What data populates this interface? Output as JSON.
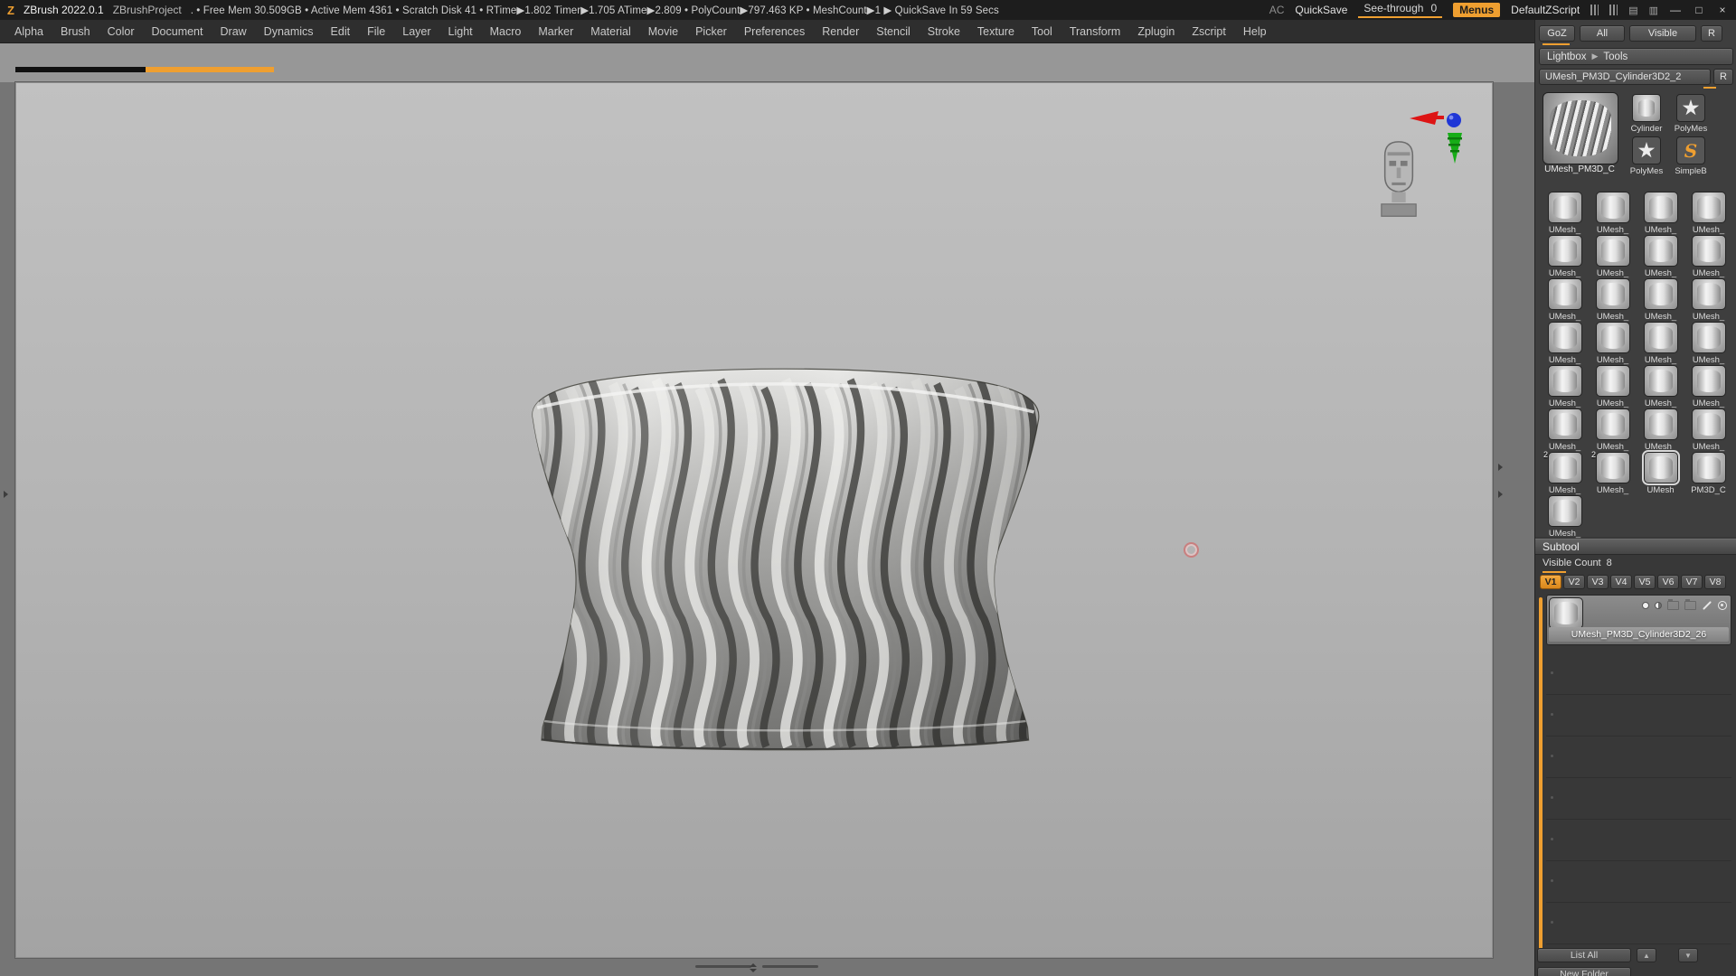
{
  "accent_color": "#ef9f30",
  "title_bar": {
    "logo": "Z",
    "app_name": "ZBrush 2022.0.1",
    "project_name": "ZBrushProject",
    "stats_prefix": ".",
    "stats": [
      {
        "sep": "•",
        "text": "Free Mem 30.509GB"
      },
      {
        "sep": "•",
        "text": "Active Mem 4361"
      },
      {
        "sep": "•",
        "text": "Scratch Disk 41"
      },
      {
        "sep": "•",
        "text": "RTime▶1.802"
      },
      {
        "sep": "",
        "text": "Timer▶1.705"
      },
      {
        "sep": "",
        "text": "ATime▶2.809"
      },
      {
        "sep": "•",
        "text": "PolyCount▶797.463 KP"
      },
      {
        "sep": "•",
        "text": "MeshCount▶1"
      },
      {
        "sep": "▶",
        "text": "QuickSave In 59 Secs"
      }
    ],
    "right": {
      "ac": "AC",
      "quicksave": "QuickSave",
      "see_through_label": "See-through",
      "see_through_value": "0",
      "menus": "Menus",
      "default_zscript": "DefaultZScript"
    }
  },
  "icons": {
    "minimize": "—",
    "restore": "□",
    "close": "×",
    "panel_a": "▤",
    "panel_b": "▥",
    "arrow_right": "▶",
    "up": "▲",
    "down": "▼"
  },
  "menu_bar": {
    "items": [
      "Alpha",
      "Brush",
      "Color",
      "Document",
      "Draw",
      "Dynamics",
      "Edit",
      "File",
      "Layer",
      "Light",
      "Macro",
      "Marker",
      "Material",
      "Movie",
      "Picker",
      "Preferences",
      "Render",
      "Stencil",
      "Stroke",
      "Texture",
      "Tool",
      "Transform",
      "Zplugin",
      "Zscript",
      "Help"
    ]
  },
  "right_panel": {
    "top_buttons": {
      "goz": "GoZ",
      "all": "All",
      "visible": "Visible",
      "r": "R"
    },
    "lightbox_label": "Lightbox",
    "tools_label": "Tools",
    "tool_name": "UMesh_PM3D_Cylinder3D2_2",
    "tool_r": "R",
    "active_tool_label": "UMesh_PM3D_C",
    "quick_items": [
      {
        "label": "Cylinder",
        "kind": "cylinder"
      },
      {
        "label": "PolyMes",
        "kind": "star"
      },
      {
        "label": "PolyMes",
        "kind": "star"
      },
      {
        "label": "SimpleB",
        "kind": "s"
      }
    ],
    "recent_tools": [
      {
        "label": "UMesh_"
      },
      {
        "label": "UMesh_"
      },
      {
        "label": "UMesh_"
      },
      {
        "label": "UMesh_"
      },
      {
        "label": "UMesh_"
      },
      {
        "label": "UMesh_"
      },
      {
        "label": "UMesh_"
      },
      {
        "label": "UMesh_"
      },
      {
        "label": "UMesh_"
      },
      {
        "label": "UMesh_"
      },
      {
        "label": "UMesh_"
      },
      {
        "label": "UMesh_"
      },
      {
        "label": "UMesh_"
      },
      {
        "label": "UMesh_"
      },
      {
        "label": "UMesh_"
      },
      {
        "label": "UMesh_"
      },
      {
        "label": "UMesh_"
      },
      {
        "label": "UMesh_"
      },
      {
        "label": "UMesh_"
      },
      {
        "label": "UMesh_"
      },
      {
        "label": "UMesh_"
      },
      {
        "label": "UMesh_"
      },
      {
        "label": "UMesh_"
      },
      {
        "label": "UMesh_"
      },
      {
        "label": "UMesh_",
        "badge": "2"
      },
      {
        "label": "UMesh_",
        "badge": "2"
      },
      {
        "label": "UMesh",
        "selected": true
      },
      {
        "label": "PM3D_C"
      },
      {
        "label": "UMesh_"
      }
    ],
    "subtool": {
      "header": "Subtool",
      "visible_count_label": "Visible Count",
      "visible_count": "8",
      "tabs": [
        "V1",
        "V2",
        "V3",
        "V4",
        "V5",
        "V6",
        "V7",
        "V8"
      ],
      "active_tab": "V1",
      "item": {
        "name": "UMesh_PM3D_Cylinder3D2_26"
      },
      "empty_rows": 7,
      "list_all": "List All",
      "clipped_button": "New Folder"
    }
  }
}
